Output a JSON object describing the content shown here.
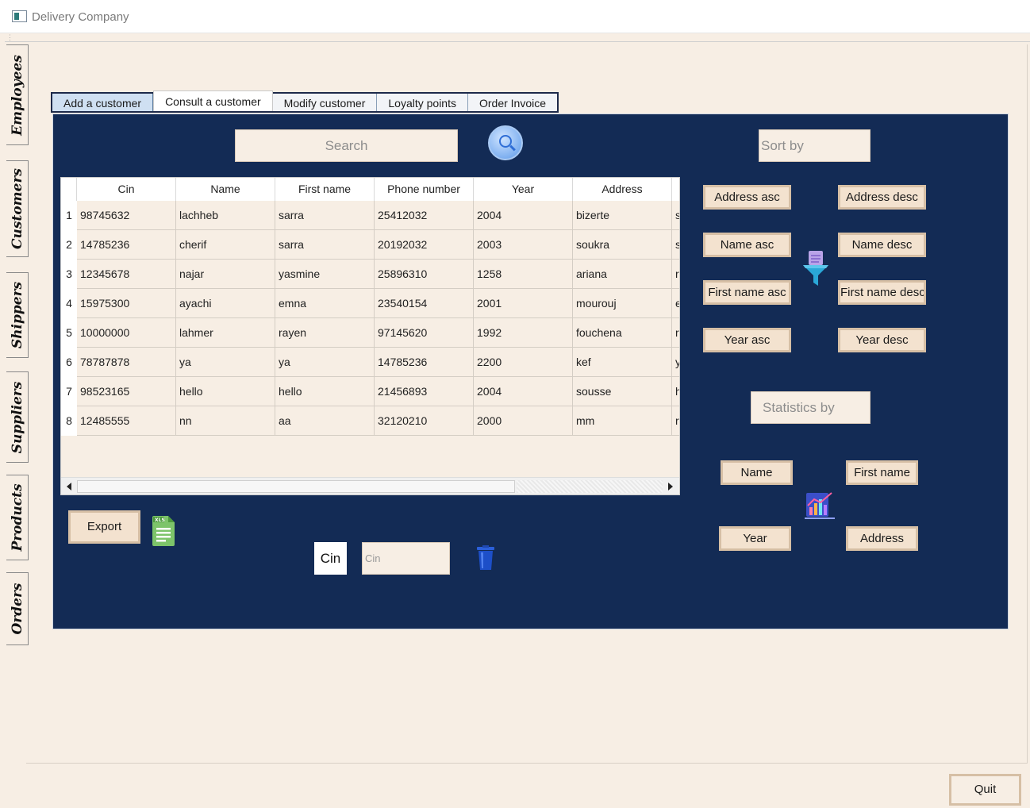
{
  "window": {
    "title": "Delivery Company"
  },
  "sidebar_tabs": [
    "Employees",
    "Customers",
    "Shippers",
    "Suppliers",
    "Products",
    "Orders"
  ],
  "tabs": [
    "Add a customer",
    "Consult a customer",
    "Modify customer",
    "Loyalty points",
    "Order Invoice"
  ],
  "active_tab": "Consult a customer",
  "search": {
    "placeholder": "Search"
  },
  "sort": {
    "placeholder": "Sort by",
    "buttons": [
      "Address asc",
      "Address desc",
      "Name asc",
      "Name desc",
      "First name asc",
      "First name desc",
      "Year asc",
      "Year desc"
    ]
  },
  "statistics": {
    "placeholder": "Statistics by",
    "buttons": [
      "Name",
      "First name",
      "Year",
      "Address"
    ]
  },
  "table": {
    "headers": [
      "Cin",
      "Name",
      "First name",
      "Phone number",
      "Year",
      "Address"
    ],
    "rows": [
      {
        "num": "1",
        "cells": [
          "98745632",
          "lachheb",
          "sarra",
          "25412032",
          "2004",
          "bizerte",
          "s"
        ]
      },
      {
        "num": "2",
        "cells": [
          "14785236",
          "cherif",
          "sarra",
          "20192032",
          "2003",
          "soukra",
          "s"
        ]
      },
      {
        "num": "3",
        "cells": [
          "12345678",
          "najar",
          "yasmine",
          "25896310",
          "1258",
          "ariana",
          "r"
        ]
      },
      {
        "num": "4",
        "cells": [
          "15975300",
          "ayachi",
          "emna",
          "23540154",
          "2001",
          "mourouj",
          "e"
        ]
      },
      {
        "num": "5",
        "cells": [
          "10000000",
          "lahmer",
          "rayen",
          "97145620",
          "1992",
          "fouchena",
          "r"
        ]
      },
      {
        "num": "6",
        "cells": [
          "78787878",
          "ya",
          "ya",
          "14785236",
          "2200",
          "kef",
          "y"
        ]
      },
      {
        "num": "7",
        "cells": [
          "98523165",
          "hello",
          "hello",
          "21456893",
          "2004",
          "sousse",
          "h"
        ]
      },
      {
        "num": "8",
        "cells": [
          "12485555",
          "nn",
          "aa",
          "32120210",
          "2000",
          "mm",
          "r"
        ]
      }
    ]
  },
  "export": {
    "label": "Export"
  },
  "delete": {
    "label": "Cin",
    "placeholder": "Cin"
  },
  "quit": {
    "label": "Quit"
  },
  "icons": {
    "search": "search-icon",
    "excel": "xls-file-icon",
    "trash": "trash-icon",
    "funnel": "filter-funnel-icon",
    "chart": "statistics-chart-icon"
  }
}
